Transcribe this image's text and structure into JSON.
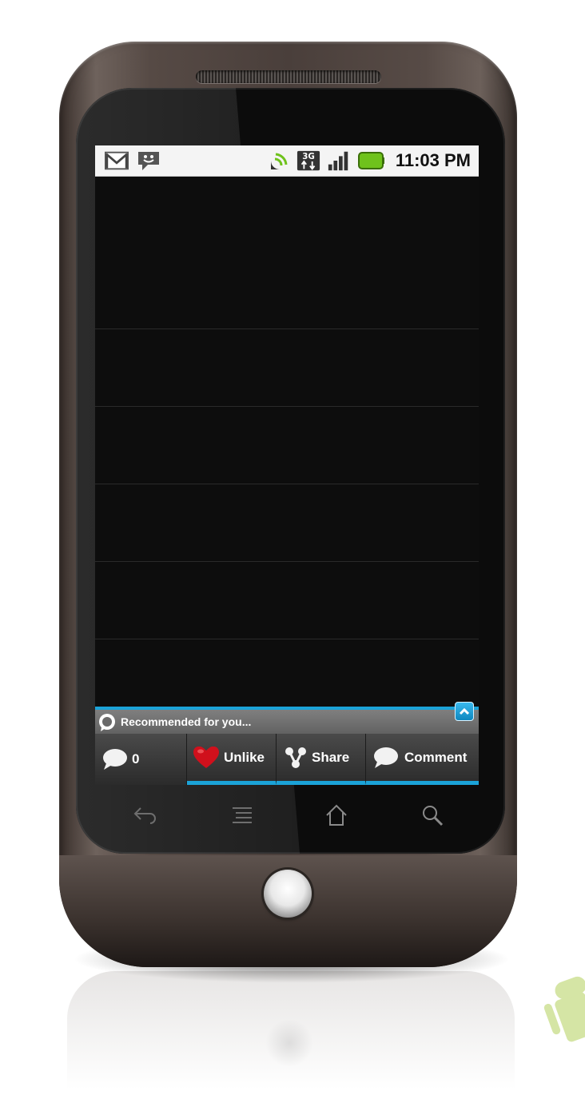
{
  "status_bar": {
    "time": "11:03 PM",
    "icons": [
      "gmail-icon",
      "chat-icon",
      "gps-icon",
      "network-3g-icon",
      "signal-icon",
      "battery-icon"
    ]
  },
  "list": {
    "rows": 6
  },
  "recommendation_bar": {
    "label": "Recommended for you..."
  },
  "actions": [
    {
      "id": "comments-count",
      "label": "0",
      "icon": "speech-bubble-icon"
    },
    {
      "id": "unlike",
      "label": "Unlike",
      "icon": "heart-icon"
    },
    {
      "id": "share",
      "label": "Share",
      "icon": "share-icon"
    },
    {
      "id": "comment",
      "label": "Comment",
      "icon": "speech-bubble-icon"
    }
  ],
  "nav_keys": [
    "back-icon",
    "menu-icon",
    "home-icon",
    "search-icon"
  ],
  "colors": {
    "accent": "#1ba3d8",
    "heart": "#d0101c",
    "battery": "#6fc21c",
    "screen_bg": "#0d0d0d"
  }
}
